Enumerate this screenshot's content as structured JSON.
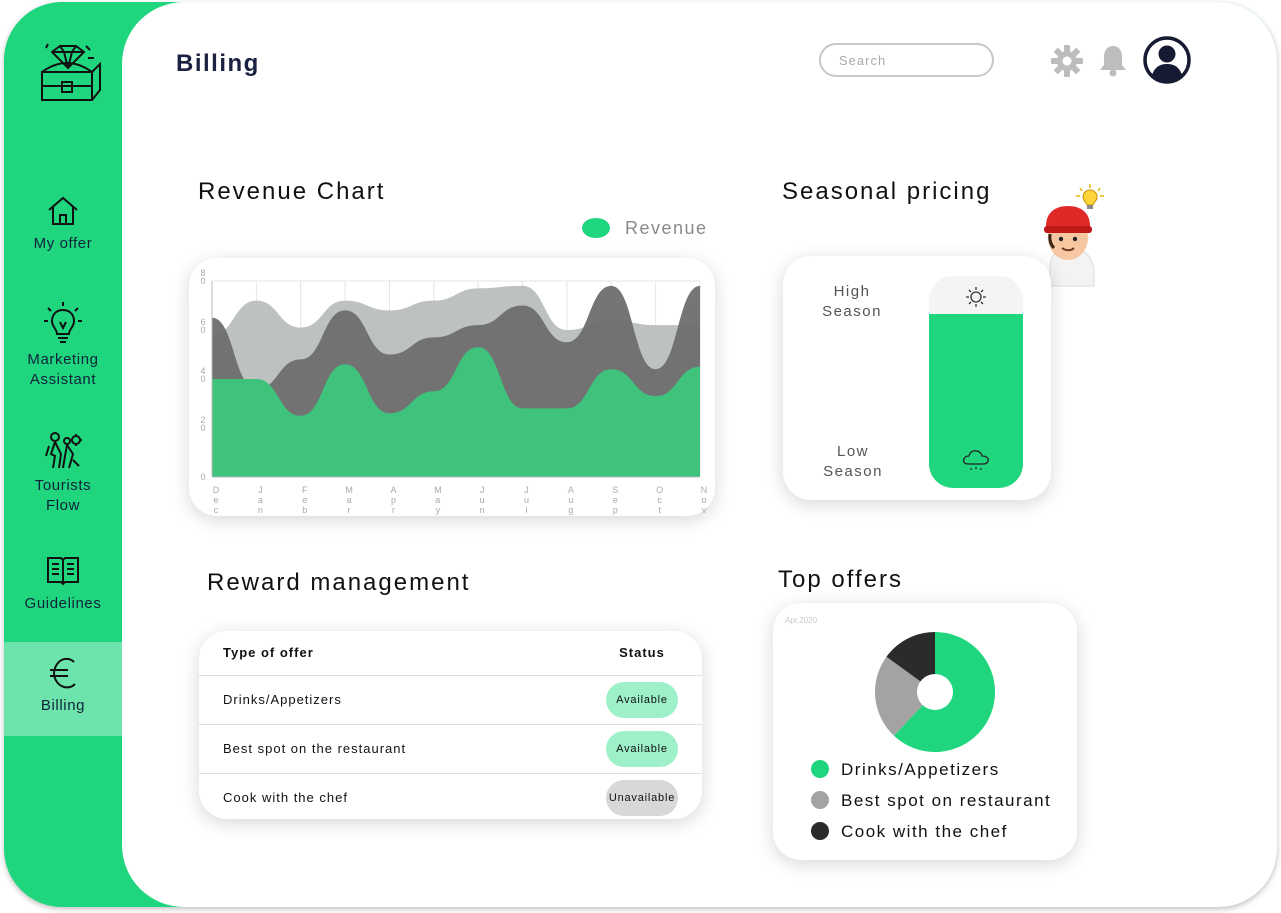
{
  "app": {
    "page_title": "Billing"
  },
  "colors": {
    "accent": "#1fd67f",
    "available_pill": "#9df0c7",
    "unavailable_pill": "#d8d8d8"
  },
  "header": {
    "search_placeholder": "Search",
    "icons": [
      "settings-icon",
      "bell-icon",
      "user-avatar-icon"
    ]
  },
  "sidebar": {
    "logo": "treasure-chest-logo",
    "items": [
      {
        "label": "My offer",
        "icon": "home-icon",
        "active": false
      },
      {
        "label": "Marketing Assistant",
        "label_lines": [
          "Marketing",
          "Assistant"
        ],
        "icon": "lightbulb-icon",
        "active": false
      },
      {
        "label": "Tourists Flow",
        "label_lines": [
          "Tourists",
          "Flow"
        ],
        "icon": "tourists-icon",
        "active": false
      },
      {
        "label": "Guidelines",
        "icon": "book-icon",
        "active": false
      },
      {
        "label": "Billing",
        "icon": "euro-icon",
        "active": true
      }
    ]
  },
  "revenue": {
    "title": "Revenue Chart",
    "legend": "Revenue",
    "chart_data": {
      "type": "area",
      "title": "Revenue Chart",
      "x": [
        "Dec",
        "Jan",
        "Feb",
        "Mar",
        "Apr",
        "May",
        "Jun",
        "Jul",
        "Aug",
        "Sep",
        "Oct",
        "Nov"
      ],
      "y_ticks": [
        "0",
        "20",
        "40",
        "60",
        "80"
      ],
      "ylim": [
        0,
        80
      ],
      "grid": true,
      "legend_position": "top-right",
      "series": [
        {
          "name": "Revenue",
          "color": "#3ec27c",
          "values": [
            40,
            40,
            25,
            46,
            26,
            35,
            53,
            28,
            28,
            44,
            33,
            45
          ]
        },
        {
          "color": "#6e6e6e",
          "values": [
            65,
            36,
            48,
            68,
            50,
            57,
            62,
            70,
            55,
            78,
            44,
            78
          ]
        },
        {
          "color": "#b9bfbe",
          "values": [
            58,
            72,
            61,
            72,
            68,
            72,
            77,
            78,
            60,
            64,
            62,
            62
          ]
        }
      ]
    }
  },
  "seasonal": {
    "title": "Seasonal pricing",
    "high_label_lines": [
      "High",
      "Season"
    ],
    "low_label_lines": [
      "Low",
      "Season"
    ],
    "level": 0.82,
    "top_icon": "sun-icon",
    "bottom_icon": "snow-cloud-icon",
    "mascot": "chef-mascot-with-lightbulb"
  },
  "rewards": {
    "title": "Reward management",
    "columns": [
      "Type of offer",
      "Status"
    ],
    "rows": [
      {
        "offer": "Drinks/Appetizers",
        "status": "Available"
      },
      {
        "offer": "Best spot on the restaurant",
        "status": "Available"
      },
      {
        "offer": "Cook with the chef",
        "status": "Unavailable"
      }
    ]
  },
  "top_offers": {
    "title": "Top offers",
    "date_label": "Apr,2020",
    "chart_data": {
      "type": "pie",
      "legend_position": "bottom",
      "slices": [
        {
          "name": "Drinks/Appetizers",
          "value": 62,
          "color": "#1fd67f"
        },
        {
          "name": "Best spot on restaurant",
          "value": 23,
          "color": "#a3a3a3"
        },
        {
          "name": "Cook with the chef",
          "value": 15,
          "color": "#2b2b2b"
        }
      ]
    }
  }
}
